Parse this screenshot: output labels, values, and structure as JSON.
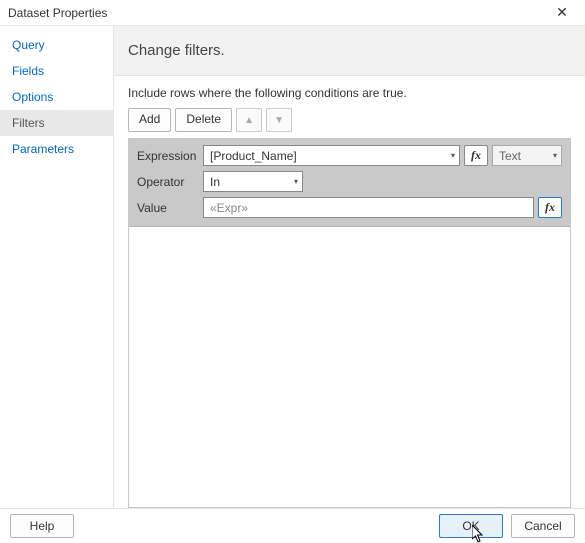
{
  "window": {
    "title": "Dataset Properties",
    "close_glyph": "✕"
  },
  "sidebar": {
    "items": [
      {
        "label": "Query",
        "selected": false
      },
      {
        "label": "Fields",
        "selected": false
      },
      {
        "label": "Options",
        "selected": false
      },
      {
        "label": "Filters",
        "selected": true
      },
      {
        "label": "Parameters",
        "selected": false
      }
    ]
  },
  "main": {
    "heading": "Change filters.",
    "instruction": "Include rows where the following conditions are true.",
    "toolbar": {
      "add_label": "Add",
      "delete_label": "Delete",
      "move_up_glyph": "▲",
      "move_down_glyph": "▼"
    },
    "filter": {
      "expression_label": "Expression",
      "expression_value": "[Product_Name]",
      "type_value": "Text",
      "operator_label": "Operator",
      "operator_value": "In",
      "value_label": "Value",
      "value_placeholder": "«Expr»",
      "fx_label": "fx"
    }
  },
  "footer": {
    "help_label": "Help",
    "ok_label": "OK",
    "cancel_label": "Cancel"
  }
}
